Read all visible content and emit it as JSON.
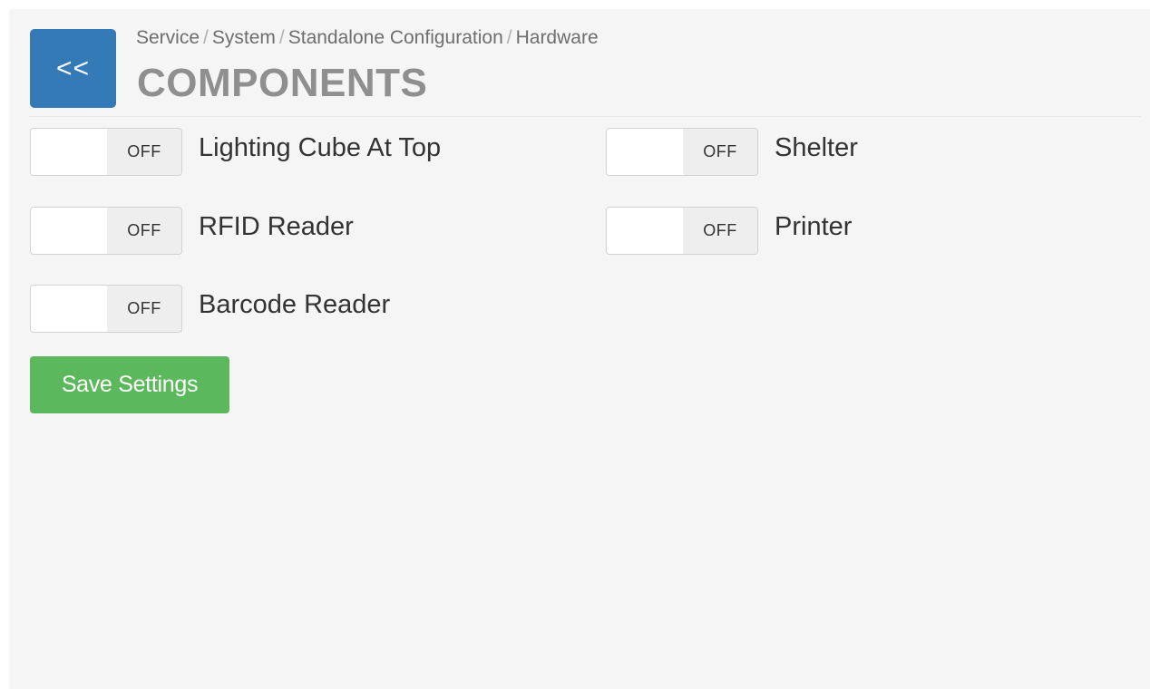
{
  "header": {
    "back_label": "<<",
    "breadcrumb": [
      "Service",
      "System",
      "Standalone Configuration",
      "Hardware"
    ],
    "breadcrumb_separator": "/",
    "title": "COMPONENTS"
  },
  "components": [
    {
      "label": "Lighting Cube At Top",
      "state": "OFF",
      "on": false
    },
    {
      "label": "Shelter",
      "state": "OFF",
      "on": false
    },
    {
      "label": "RFID Reader",
      "state": "OFF",
      "on": false
    },
    {
      "label": "Printer",
      "state": "OFF",
      "on": false
    },
    {
      "label": "Barcode Reader",
      "state": "OFF",
      "on": false
    }
  ],
  "actions": {
    "save_label": "Save Settings"
  },
  "colors": {
    "back_button": "#337ab7",
    "save_button": "#5cb85c",
    "title": "#8f8f8f",
    "panel_background": "#f5f5f5"
  }
}
